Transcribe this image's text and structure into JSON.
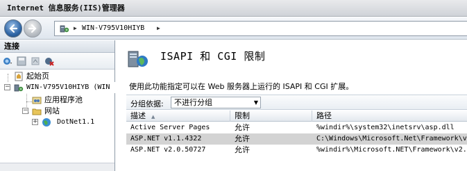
{
  "window": {
    "title": "Internet 信息服务(IIS)管理器"
  },
  "nav": {
    "address_item": "WIN-V795V10HIYB"
  },
  "connections": {
    "header": "连接",
    "tree": {
      "start_page": "起始页",
      "server": "WIN-V795V10HIYB (WIN",
      "app_pools": "应用程序池",
      "sites": "网站",
      "site_dotnet": "DotNet1.1"
    }
  },
  "main": {
    "title": "ISAPI 和 CGI 限制",
    "description": "使用此功能指定可以在 Web 服务器上运行的 ISAPI 和 CGI 扩展。",
    "group_by": {
      "label": "分组依据:",
      "value": "不进行分组"
    },
    "columns": {
      "description": "描述",
      "restriction": "限制",
      "path": "路径"
    },
    "rows": [
      {
        "description": "Active Server Pages",
        "restriction": "允许",
        "path": "%windir%\\system32\\inetsrv\\asp.dll",
        "selected": false
      },
      {
        "description": "ASP.NET v1.1.4322",
        "restriction": "允许",
        "path": "C:\\Windows\\Microsoft.Net\\Framework\\v",
        "selected": true
      },
      {
        "description": "ASP.NET v2.0.50727",
        "restriction": "允许",
        "path": "%windir%\\Microsoft.NET\\Framework\\v2.",
        "selected": false
      }
    ]
  },
  "icons": {
    "back": "back-arrow-icon",
    "forward": "forward-arrow-icon",
    "address": "server-icon",
    "main": "isapi-cgi-icon"
  },
  "colors": {
    "selection": "#d3d3d3",
    "back_button": "#2f66a6"
  }
}
